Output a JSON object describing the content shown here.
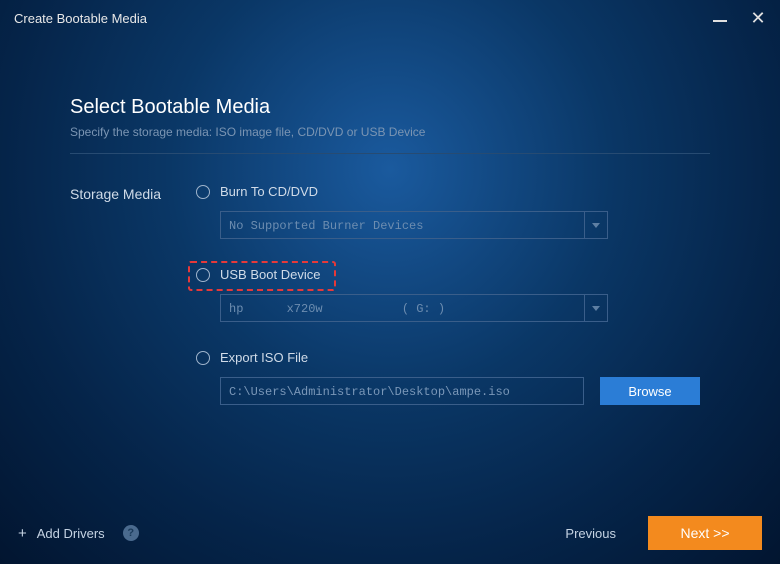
{
  "titlebar": {
    "title": "Create Bootable Media"
  },
  "page": {
    "heading": "Select Bootable Media",
    "subtitle": "Specify the storage media: ISO image file, CD/DVD or USB Device"
  },
  "storage": {
    "label": "Storage Media",
    "options": {
      "cddvd": {
        "label": "Burn To CD/DVD",
        "value": "No Supported Burner Devices"
      },
      "usb": {
        "label": "USB Boot Device",
        "value": "hp      x720w           ( G: )"
      },
      "iso": {
        "label": "Export ISO File",
        "path": "C:\\Users\\Administrator\\Desktop\\ampe.iso",
        "browse": "Browse"
      }
    }
  },
  "footer": {
    "add_drivers": "Add Drivers",
    "previous": "Previous",
    "next": "Next >>"
  }
}
